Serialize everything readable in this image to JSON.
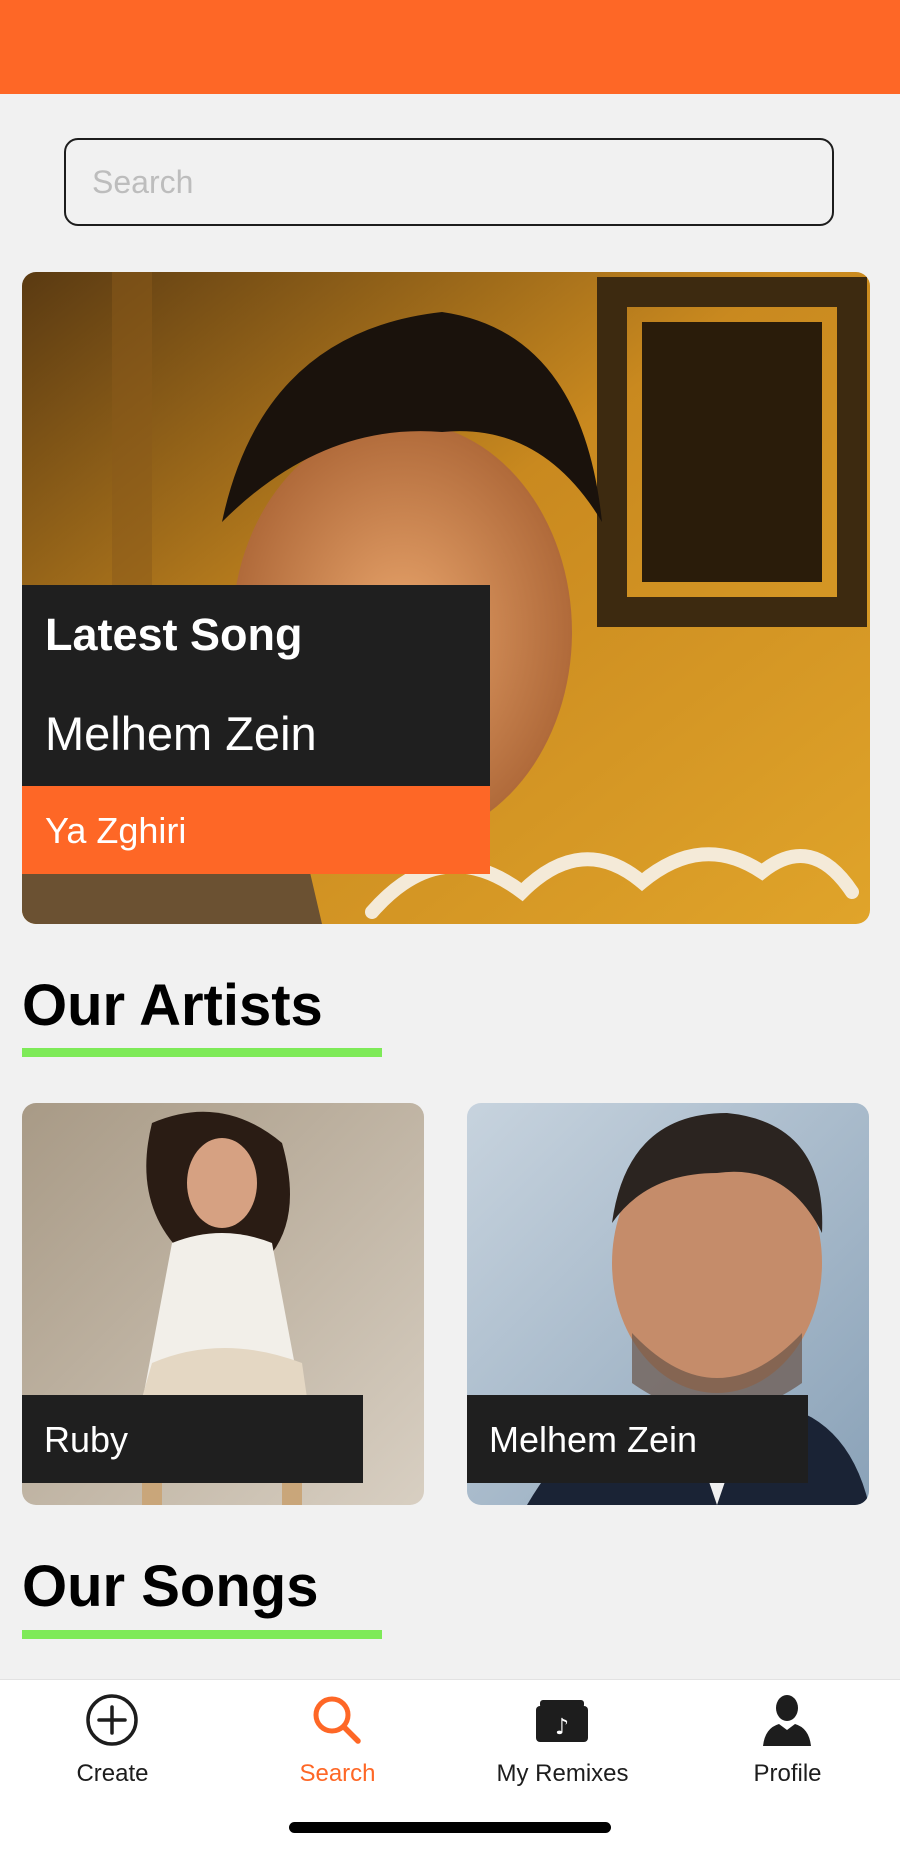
{
  "header": {
    "color": "#fe6726"
  },
  "search": {
    "placeholder": "Search",
    "value": ""
  },
  "hero": {
    "kicker": "Latest Song",
    "artist": "Melhem Zein",
    "song": "Ya Zghiri",
    "image_icon": "album-cover-image"
  },
  "artists_section": {
    "title": "Our Artists",
    "underline_color": "#7eea58",
    "items": [
      {
        "name": "Ruby",
        "image_icon": "artist-photo"
      },
      {
        "name": "Melhem Zein",
        "image_icon": "artist-photo"
      }
    ]
  },
  "songs_section": {
    "title": "Our Songs",
    "underline_color": "#7eea58"
  },
  "tab_bar": {
    "active_color": "#fe6726",
    "tabs": [
      {
        "label": "Create",
        "icon": "plus-circle-icon",
        "active": false
      },
      {
        "label": "Search",
        "icon": "search-icon",
        "active": true
      },
      {
        "label": "My Remixes",
        "icon": "music-archive-icon",
        "active": false
      },
      {
        "label": "Profile",
        "icon": "person-icon",
        "active": false
      }
    ]
  }
}
